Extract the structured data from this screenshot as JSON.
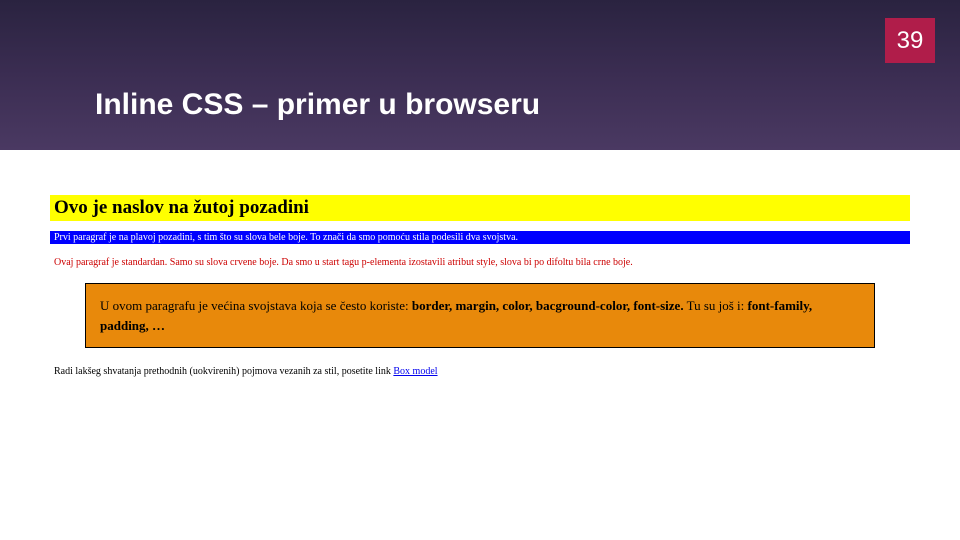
{
  "header": {
    "title": "Inline CSS – primer u browseru",
    "page_number": "39"
  },
  "content": {
    "yellow_heading": "Ovo je naslov na žutoj pozadini",
    "blue_paragraph": "Prvi paragraf je na plavoj pozadini, s tim što su slova bele boje. To znači da smo pomoću stila podesili dva svojstva.",
    "red_paragraph": "Ovaj paragraf je standardan. Samo su slova crvene boje. Da smo u start tagu p-elementa izostavili atribut style, slova bi po difoltu bila crne boje.",
    "orange_prefix": "U ovom paragrafu je većina svojstava koja se često koriste: ",
    "orange_bold1": "border, margin, color, bacground-color, font-size.",
    "orange_mid": " Tu su još i: ",
    "orange_bold2": "font-family, padding, …",
    "plain_prefix": "Radi lakšeg shvatanja prethodnih (uokvirenih) pojmova vezanih za stil, posetite link ",
    "plain_link": "Box model"
  }
}
